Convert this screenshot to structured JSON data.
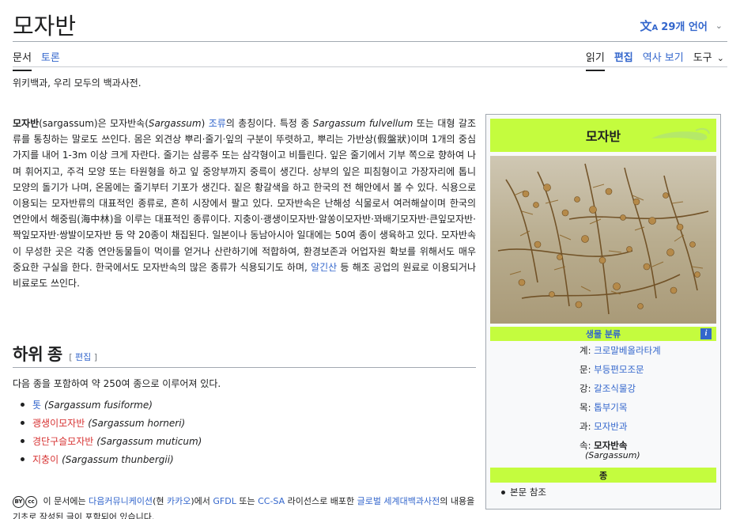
{
  "header": {
    "title": "모자반",
    "lang_icon": "translate-icon",
    "lang_label": "29개 언어",
    "lang_chevron": "⌄"
  },
  "tabs_left": [
    {
      "label": "문서",
      "active": true
    },
    {
      "label": "토론",
      "active": false
    }
  ],
  "tabs_right": [
    {
      "label": "읽기"
    },
    {
      "label": "편집"
    },
    {
      "label": "역사 보기"
    },
    {
      "label": "도구"
    }
  ],
  "tools_chevron": "⌄",
  "tagline": "위키백과, 우리 모두의 백과사전.",
  "article": {
    "bold_term": "모자반",
    "seg1": "(sargassum)은 모자반속(",
    "genus_italic": "Sargassum",
    "seg2": ") ",
    "link_algae": "조류",
    "seg3": "의 총칭이다. 특정 종 ",
    "fulvellum_italic": "Sargassum fulvellum",
    "seg4": " 또는 대형 갈조류를 통칭하는 말로도 쓰인다. 몸은 외견상 뿌리·줄기·잎의 구분이 뚜렷하고, 뿌리는 가반상(假盤狀)이며 1개의 중심 가지를 내어 1-3m 이상 크게 자란다. 줄기는 삼릉주 또는 삼각형이고 비틀린다. 잎은 줄기에서 기부 쪽으로 향하여 나며 휘어지고, 주걱 모양 또는 타원형을 하고 잎 중앙부까지 중륵이 생긴다. 상부의 잎은 피침형이고 가장자리에 톱니 모양의 돌기가 나며, 온몸에는 줄기부터 기포가 생긴다. 짙은 황갈색을 하고 한국의 전 해안에서 볼 수 있다. 식용으로 이용되는 모자반류의 대표적인 종류로, 흔히 시장에서 팔고 있다. 모자반속은 난해성 식물로서 여러해살이며 한국의 연안에서 해중림(海中林)을 이루는 대표적인 종류이다. 지충이·괭생이모자반·알쏭이모자반·꽈배기모자반·큰잎모자반·짝잎모자반·쌍발이모자반 등 약 20종이 채집된다. 일본이나 동남아시아 일대에는 50여 종이 생육하고 있다. 모자반속이 무성한 곳은 각종 연안동물들이 먹이를 얻거나 산란하기에 적합하여, 환경보존과 어업자원 확보를 위해서도 매우 중요한 구실을 한다. 한국에서도 모자반속의 많은 종류가 식용되기도 하며, ",
    "link_alginate": "알긴산",
    "seg5": " 등 해조 공업의 원료로 이용되거나 비료로도 쓰인다."
  },
  "section": {
    "heading": "하위 종",
    "edit_open": "[",
    "edit_label": "편집",
    "edit_close": "]",
    "intro": "다음 종을 포함하여 약 250여 종으로 이루어져 있다.",
    "species": [
      {
        "name": "톳",
        "sci": "(Sargassum fusiforme)",
        "link_color": "blue"
      },
      {
        "name": "괭생이모자반",
        "sci": "(Sargassum horneri)",
        "link_color": "red"
      },
      {
        "name": "경단구슬모자반",
        "sci": "(Sargassum muticum)",
        "link_color": "red"
      },
      {
        "name": "지충이",
        "sci": "(Sargassum thunbergii)",
        "link_color": "red"
      }
    ]
  },
  "license": {
    "icons": [
      "cc-by-icon",
      "cc-icon"
    ],
    "icon_text_by": "BY",
    "icon_text_cc": "cc",
    "seg1": " 이 문서에는 ",
    "link1": "다음커뮤니케이션",
    "seg2": "(현 ",
    "link2": "카카오",
    "seg3": ")에서 ",
    "link3": "GFDL",
    "seg4": " 또는 ",
    "link4": "CC-SA",
    "seg5": " 라이선스로 배포한 ",
    "link5": "글로벌 세계대백과사전",
    "seg6": "의 내용을 기초로 작성된 글이 포함되어 있습니다."
  },
  "infobox": {
    "title": "모자반",
    "classification_label": "생물 분류",
    "info_icon_label": "i",
    "ranks": [
      {
        "rank": "계:",
        "value": "크로말베올라타계",
        "link": true
      },
      {
        "rank": "문:",
        "value": "부등편모조문",
        "link": true
      },
      {
        "rank": "강:",
        "value": "갈조식물강",
        "link": true
      },
      {
        "rank": "목:",
        "value": "톱부기목",
        "link": true
      },
      {
        "rank": "과:",
        "value": "모자반과",
        "link": true
      },
      {
        "rank": "속:",
        "value": "모자반속",
        "link": false
      }
    ],
    "genus_sci": "(Sargassum)",
    "species_label": "종",
    "species_item": "본문 참조"
  },
  "colors": {
    "link": "#3366cc",
    "redlink": "#d73333",
    "infobox_band": "#c4fc3e",
    "text": "#202122"
  }
}
